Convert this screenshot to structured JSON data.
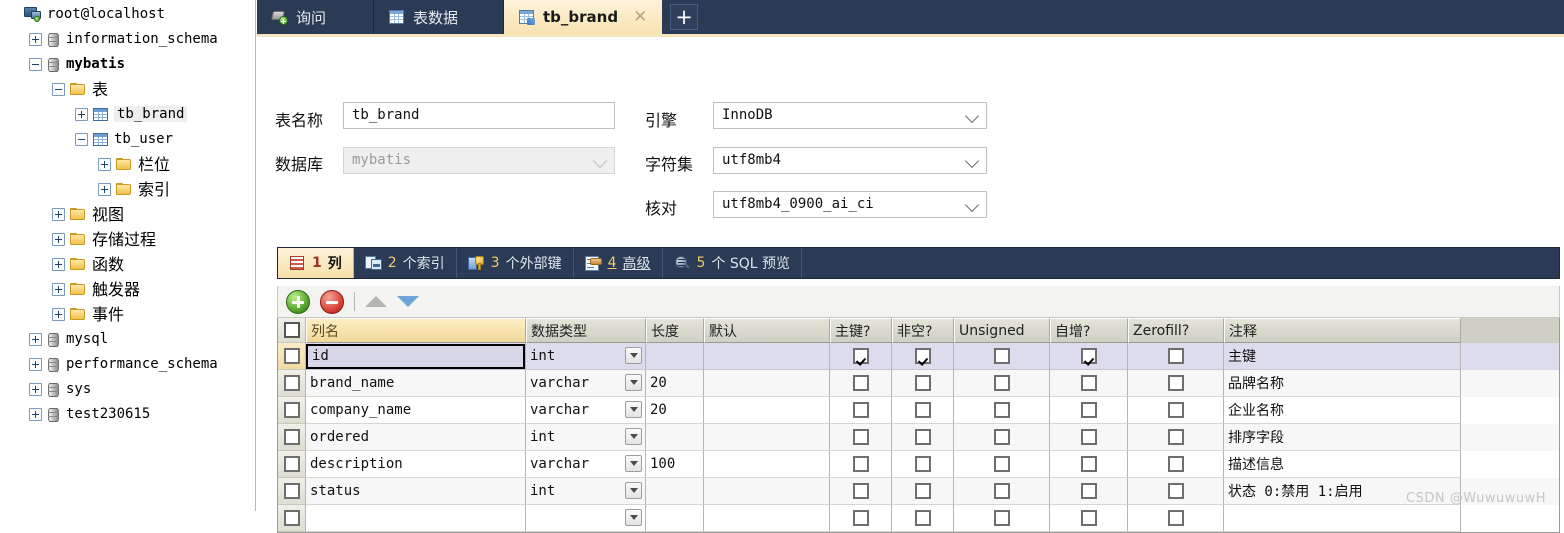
{
  "sidebar": {
    "tree": [
      {
        "label": "root@localhost",
        "icon": "server-icon",
        "indent": 0,
        "expander": "none",
        "bold": false,
        "cjk": false,
        "selected": false
      },
      {
        "label": "information_schema",
        "icon": "database-icon",
        "indent": 1,
        "expander": "plus",
        "bold": false,
        "cjk": false,
        "selected": false
      },
      {
        "label": "mybatis",
        "icon": "database-icon",
        "indent": 1,
        "expander": "minus",
        "bold": true,
        "cjk": false,
        "selected": false
      },
      {
        "label": "表",
        "icon": "folder-icon",
        "indent": 2,
        "expander": "minus",
        "bold": false,
        "cjk": true,
        "selected": false
      },
      {
        "label": "tb_brand",
        "icon": "table-icon",
        "indent": 3,
        "expander": "plus",
        "bold": false,
        "cjk": false,
        "selected": true
      },
      {
        "label": "tb_user",
        "icon": "table-icon",
        "indent": 3,
        "expander": "minus",
        "bold": false,
        "cjk": false,
        "selected": false
      },
      {
        "label": "栏位",
        "icon": "folder-icon",
        "indent": 4,
        "expander": "plus",
        "bold": false,
        "cjk": true,
        "selected": false
      },
      {
        "label": "索引",
        "icon": "folder-icon",
        "indent": 4,
        "expander": "plus",
        "bold": false,
        "cjk": true,
        "selected": false
      },
      {
        "label": "视图",
        "icon": "folder-icon",
        "indent": 2,
        "expander": "plus",
        "bold": false,
        "cjk": true,
        "selected": false
      },
      {
        "label": "存储过程",
        "icon": "folder-icon",
        "indent": 2,
        "expander": "plus",
        "bold": false,
        "cjk": true,
        "selected": false
      },
      {
        "label": "函数",
        "icon": "folder-icon",
        "indent": 2,
        "expander": "plus",
        "bold": false,
        "cjk": true,
        "selected": false
      },
      {
        "label": "触发器",
        "icon": "folder-icon",
        "indent": 2,
        "expander": "plus",
        "bold": false,
        "cjk": true,
        "selected": false
      },
      {
        "label": "事件",
        "icon": "folder-icon",
        "indent": 2,
        "expander": "plus",
        "bold": false,
        "cjk": true,
        "selected": false
      },
      {
        "label": "mysql",
        "icon": "database-icon",
        "indent": 1,
        "expander": "plus",
        "bold": false,
        "cjk": false,
        "selected": false
      },
      {
        "label": "performance_schema",
        "icon": "database-icon",
        "indent": 1,
        "expander": "plus",
        "bold": false,
        "cjk": false,
        "selected": false
      },
      {
        "label": "sys",
        "icon": "database-icon",
        "indent": 1,
        "expander": "plus",
        "bold": false,
        "cjk": false,
        "selected": false
      },
      {
        "label": "test230615",
        "icon": "database-icon",
        "indent": 1,
        "expander": "plus",
        "bold": false,
        "cjk": false,
        "selected": false
      }
    ]
  },
  "tabs": {
    "items": [
      {
        "label": "询问",
        "icon": "query-icon",
        "active": false,
        "closable": false
      },
      {
        "label": "表数据",
        "icon": "grid-icon",
        "active": false,
        "closable": false
      },
      {
        "label": "tb_brand",
        "icon": "table-design-icon",
        "active": true,
        "closable": true,
        "close": "✕"
      }
    ],
    "new_tab_label": "+"
  },
  "form": {
    "table_name_label": "表名称",
    "table_name_value": "tb_brand",
    "database_label": "数据库",
    "database_value": "mybatis",
    "engine_label": "引擎",
    "engine_value": "InnoDB",
    "charset_label": "字符集",
    "charset_value": "utf8mb4",
    "collation_label": "核对",
    "collation_value": "utf8mb4_0900_ai_ci"
  },
  "subtabs": [
    {
      "num": "1",
      "text": "列",
      "icon": "columns-icon",
      "active": true,
      "underline": false
    },
    {
      "num": "2",
      "text": "个索引",
      "icon": "index-icon",
      "active": false,
      "underline": false
    },
    {
      "num": "3",
      "text": "个外部键",
      "icon": "foreign-key-icon",
      "active": false,
      "underline": false
    },
    {
      "num": "4",
      "text": "高级",
      "icon": "advanced-icon",
      "active": false,
      "underline": true
    },
    {
      "num": "5",
      "text": "个 SQL 预览",
      "icon": "sql-preview-icon",
      "active": false,
      "underline": false
    }
  ],
  "toolbar": {
    "add_label": "",
    "delete_label": "",
    "move_up_label": "",
    "move_down_label": ""
  },
  "grid": {
    "headers": [
      "列名",
      "数据类型",
      "长度",
      "默认",
      "主键?",
      "非空?",
      "Unsigned",
      "自增?",
      "Zerofill?",
      "注释"
    ],
    "rows": [
      {
        "name": "id",
        "type": "int",
        "length": "",
        "default": "",
        "pk": true,
        "notnull": true,
        "unsigned": false,
        "autoinc": true,
        "zerofill": false,
        "comment": "主键",
        "selected": true
      },
      {
        "name": "brand_name",
        "type": "varchar",
        "length": "20",
        "default": "",
        "pk": false,
        "notnull": false,
        "unsigned": false,
        "autoinc": false,
        "zerofill": false,
        "comment": "品牌名称",
        "selected": false
      },
      {
        "name": "company_name",
        "type": "varchar",
        "length": "20",
        "default": "",
        "pk": false,
        "notnull": false,
        "unsigned": false,
        "autoinc": false,
        "zerofill": false,
        "comment": "企业名称",
        "selected": false
      },
      {
        "name": "ordered",
        "type": "int",
        "length": "",
        "default": "",
        "pk": false,
        "notnull": false,
        "unsigned": false,
        "autoinc": false,
        "zerofill": false,
        "comment": "排序字段",
        "selected": false
      },
      {
        "name": "description",
        "type": "varchar",
        "length": "100",
        "default": "",
        "pk": false,
        "notnull": false,
        "unsigned": false,
        "autoinc": false,
        "zerofill": false,
        "comment": "描述信息",
        "selected": false
      },
      {
        "name": "status",
        "type": "int",
        "length": "",
        "default": "",
        "pk": false,
        "notnull": false,
        "unsigned": false,
        "autoinc": false,
        "zerofill": false,
        "comment": "状态 0:禁用 1:启用",
        "selected": false
      },
      {
        "name": "",
        "type": "",
        "length": "",
        "default": "",
        "pk": false,
        "notnull": false,
        "unsigned": false,
        "autoinc": false,
        "zerofill": false,
        "comment": "",
        "selected": false
      }
    ]
  },
  "watermark": "CSDN @WuwuwuwH",
  "colors": {
    "tabbar_bg": "#2b3a55",
    "active_tab": "#f8e3b0",
    "grid_header": "#cfcfc4",
    "colname_header": "#f2d89a",
    "selected_row": "#dcded0"
  }
}
